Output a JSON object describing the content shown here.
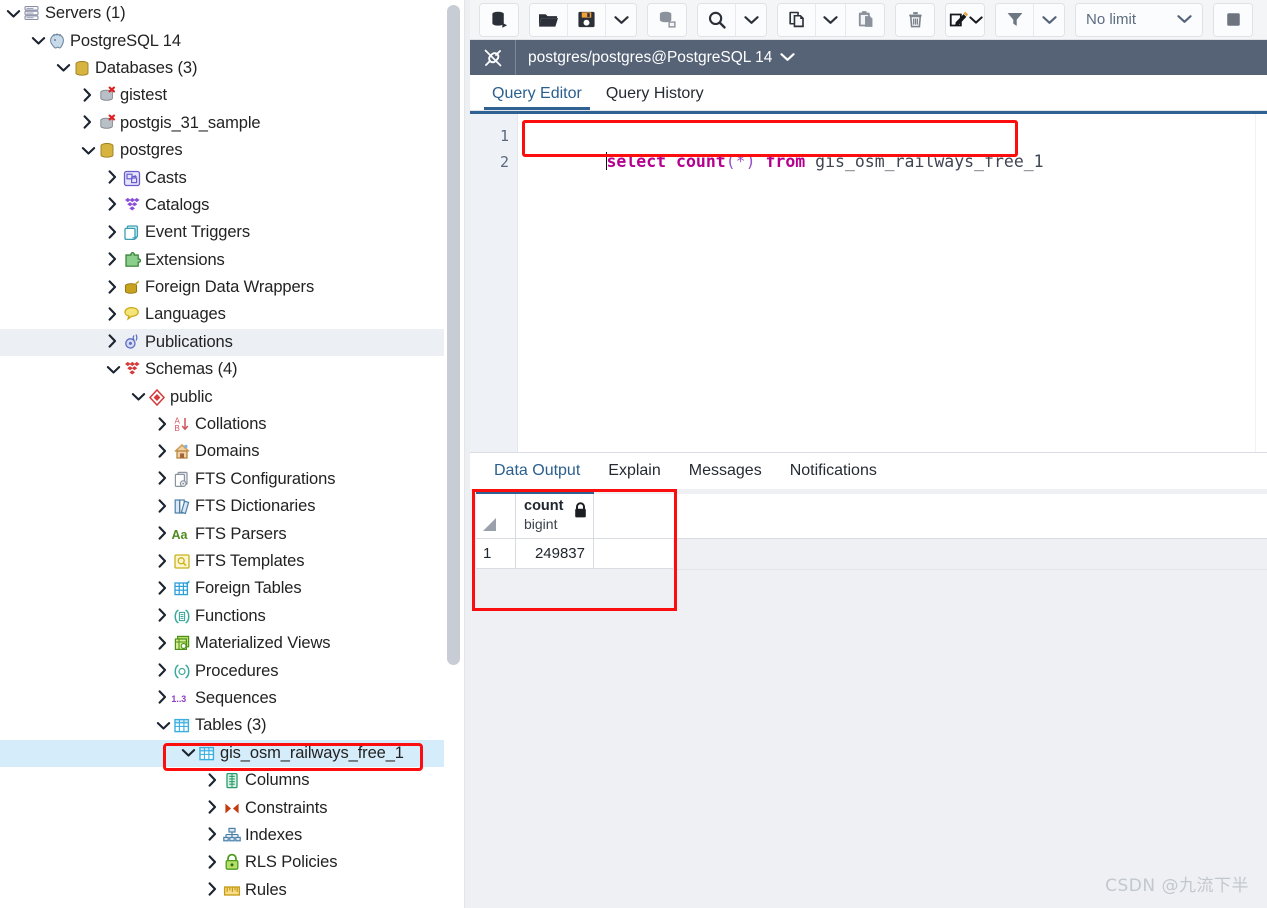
{
  "tree": {
    "name": "object-browser-tree",
    "nodes": [
      {
        "label": "Servers (1)",
        "depth": 0,
        "state": "open",
        "icon": "servers-icon",
        "highlight": "none"
      },
      {
        "label": "PostgreSQL 14",
        "depth": 1,
        "state": "open",
        "icon": "postgresql-elephant-icon",
        "highlight": "none"
      },
      {
        "label": "Databases (3)",
        "depth": 2,
        "state": "open",
        "icon": "databases-icon",
        "highlight": "none"
      },
      {
        "label": "gistest",
        "depth": 3,
        "state": "closed",
        "icon": "database-disconnected-icon",
        "highlight": "none"
      },
      {
        "label": "postgis_31_sample",
        "depth": 3,
        "state": "closed",
        "icon": "database-disconnected-icon",
        "highlight": "none"
      },
      {
        "label": "postgres",
        "depth": 3,
        "state": "open",
        "icon": "database-icon",
        "highlight": "none"
      },
      {
        "label": "Casts",
        "depth": 4,
        "state": "closed",
        "icon": "casts-icon",
        "highlight": "none"
      },
      {
        "label": "Catalogs",
        "depth": 4,
        "state": "closed",
        "icon": "catalogs-icon",
        "highlight": "none"
      },
      {
        "label": "Event Triggers",
        "depth": 4,
        "state": "closed",
        "icon": "event-triggers-icon",
        "highlight": "none"
      },
      {
        "label": "Extensions",
        "depth": 4,
        "state": "closed",
        "icon": "extensions-icon",
        "highlight": "none"
      },
      {
        "label": "Foreign Data Wrappers",
        "depth": 4,
        "state": "closed",
        "icon": "foreign-data-wrappers-icon",
        "highlight": "none"
      },
      {
        "label": "Languages",
        "depth": 4,
        "state": "closed",
        "icon": "languages-icon",
        "highlight": "none"
      },
      {
        "label": "Publications",
        "depth": 4,
        "state": "closed",
        "icon": "publications-icon",
        "highlight": "grey"
      },
      {
        "label": "Schemas (4)",
        "depth": 4,
        "state": "open",
        "icon": "schemas-icon",
        "highlight": "none"
      },
      {
        "label": "public",
        "depth": 5,
        "state": "open",
        "icon": "schema-public-icon",
        "highlight": "none"
      },
      {
        "label": "Collations",
        "depth": 6,
        "state": "closed",
        "icon": "collations-icon",
        "highlight": "none"
      },
      {
        "label": "Domains",
        "depth": 6,
        "state": "closed",
        "icon": "domains-icon",
        "highlight": "none"
      },
      {
        "label": "FTS Configurations",
        "depth": 6,
        "state": "closed",
        "icon": "fts-configurations-icon",
        "highlight": "none"
      },
      {
        "label": "FTS Dictionaries",
        "depth": 6,
        "state": "closed",
        "icon": "fts-dictionaries-icon",
        "highlight": "none"
      },
      {
        "label": "FTS Parsers",
        "depth": 6,
        "state": "closed",
        "icon": "fts-parsers-icon",
        "highlight": "none"
      },
      {
        "label": "FTS Templates",
        "depth": 6,
        "state": "closed",
        "icon": "fts-templates-icon",
        "highlight": "none"
      },
      {
        "label": "Foreign Tables",
        "depth": 6,
        "state": "closed",
        "icon": "foreign-tables-icon",
        "highlight": "none"
      },
      {
        "label": "Functions",
        "depth": 6,
        "state": "closed",
        "icon": "functions-icon",
        "highlight": "none"
      },
      {
        "label": "Materialized Views",
        "depth": 6,
        "state": "closed",
        "icon": "materialized-views-icon",
        "highlight": "none"
      },
      {
        "label": "Procedures",
        "depth": 6,
        "state": "closed",
        "icon": "procedures-icon",
        "highlight": "none"
      },
      {
        "label": "Sequences",
        "depth": 6,
        "state": "closed",
        "icon": "sequences-icon",
        "highlight": "none"
      },
      {
        "label": "Tables (3)",
        "depth": 6,
        "state": "open",
        "icon": "tables-icon",
        "highlight": "none"
      },
      {
        "label": "gis_osm_railways_free_1",
        "depth": 7,
        "state": "open",
        "icon": "table-icon",
        "highlight": "blue"
      },
      {
        "label": "Columns",
        "depth": 8,
        "state": "closed",
        "icon": "columns-icon",
        "highlight": "none"
      },
      {
        "label": "Constraints",
        "depth": 8,
        "state": "closed",
        "icon": "constraints-icon",
        "highlight": "none"
      },
      {
        "label": "Indexes",
        "depth": 8,
        "state": "closed",
        "icon": "indexes-icon",
        "highlight": "none"
      },
      {
        "label": "RLS Policies",
        "depth": 8,
        "state": "closed",
        "icon": "rls-policies-icon",
        "highlight": "none"
      },
      {
        "label": "Rules",
        "depth": 8,
        "state": "closed",
        "icon": "rules-icon",
        "highlight": "none"
      }
    ]
  },
  "toolbar": {
    "groups": [
      {
        "buttons": [
          {
            "name": "open-query-tool-button",
            "icon": "query-tool-icon"
          }
        ]
      },
      {
        "buttons": [
          {
            "name": "open-file-button",
            "icon": "folder-open-icon"
          },
          {
            "name": "save-file-button",
            "icon": "save-floppy-icon"
          },
          {
            "name": "save-options-caret",
            "icon": "chevron-down-icon"
          }
        ]
      },
      {
        "buttons": [
          {
            "name": "view-data-button",
            "icon": "database-edit-icon"
          }
        ]
      },
      {
        "buttons": [
          {
            "name": "find-button",
            "icon": "search-magnifier-icon"
          },
          {
            "name": "find-options-caret",
            "icon": "chevron-down-icon"
          }
        ]
      },
      {
        "buttons": [
          {
            "name": "copy-button",
            "icon": "copy-icon"
          },
          {
            "name": "copy-options-caret",
            "icon": "chevron-down-icon"
          },
          {
            "name": "paste-button",
            "icon": "paste-icon"
          }
        ]
      },
      {
        "buttons": [
          {
            "name": "delete-row-button",
            "icon": "trash-icon"
          }
        ]
      },
      {
        "buttons": [
          {
            "name": "execute-script-button",
            "icon": "edit-pencil-icon"
          },
          {
            "name": "execute-options-caret",
            "icon": "chevron-down-icon"
          }
        ]
      },
      {
        "buttons": [
          {
            "name": "filter-button",
            "icon": "filter-funnel-icon"
          },
          {
            "name": "filter-options-caret",
            "icon": "chevron-down-icon"
          }
        ]
      }
    ],
    "row_limit": {
      "label": "No limit",
      "name": "row-limit-select"
    },
    "stop_button": {
      "name": "stop-query-button",
      "icon": "stop-square-icon"
    }
  },
  "connection": {
    "icon": "connection-plug-icon",
    "label": "postgres/postgres@PostgreSQL 14",
    "caret": "chevron-down-icon"
  },
  "editor_tabs": [
    {
      "label": "Query Editor",
      "active": true
    },
    {
      "label": "Query History",
      "active": false
    }
  ],
  "sql": {
    "lines": [
      "1",
      "2"
    ],
    "tokens": [
      {
        "t": "select",
        "k": "kw"
      },
      {
        "t": " ",
        "k": "ident"
      },
      {
        "t": "count",
        "k": "kw"
      },
      {
        "t": "(*)",
        "k": "punc"
      },
      {
        "t": " ",
        "k": "ident"
      },
      {
        "t": "from",
        "k": "kw"
      },
      {
        "t": " gis_osm_railways_free_1",
        "k": "ident"
      }
    ],
    "plain_text": "select count(*) from gis_osm_railways_free_1"
  },
  "output_tabs": [
    {
      "label": "Data Output",
      "active": true
    },
    {
      "label": "Explain",
      "active": false
    },
    {
      "label": "Messages",
      "active": false
    },
    {
      "label": "Notifications",
      "active": false
    }
  ],
  "grid": {
    "columns": [
      {
        "name": "count",
        "type": "bigint",
        "locked": true,
        "lock_icon": "lock-icon"
      }
    ],
    "rows": [
      {
        "num": "1",
        "values": [
          "249837"
        ]
      }
    ]
  },
  "watermark": {
    "text": "CSDN @九流下半"
  },
  "colors": {
    "accent_blue": "#2f6193",
    "highlight_red": "#fd0e0e",
    "selected_row_blue": "#d5ecfb",
    "connbar_bg": "#566377",
    "keyword_magenta": "#b5008f"
  }
}
